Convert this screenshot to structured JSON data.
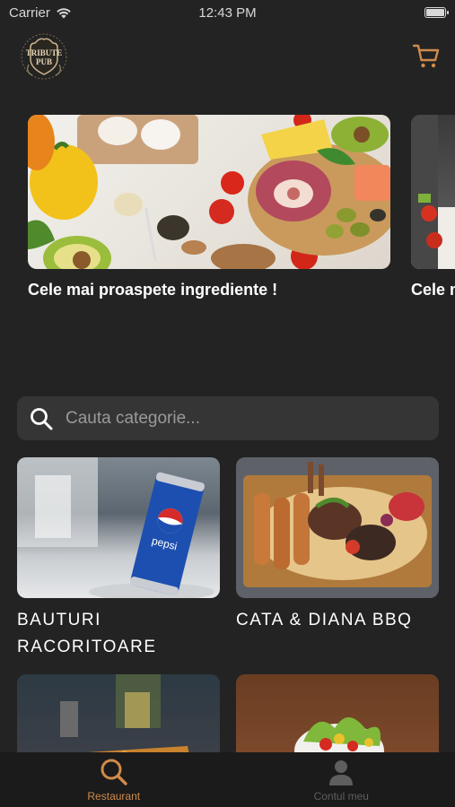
{
  "status_bar": {
    "carrier": "Carrier",
    "time": "12:43 PM"
  },
  "header": {
    "logo_icon": "tribute-pub-logo",
    "cart_icon": "cart-icon"
  },
  "banners": [
    {
      "caption": "Cele mai proaspete ingrediente !"
    },
    {
      "caption": "Cele mai proaspete ingrediente !"
    }
  ],
  "search": {
    "placeholder": "Cauta categorie...",
    "value": ""
  },
  "categories": [
    {
      "name": "BAUTURI RACORITOARE"
    },
    {
      "name": "CATA & DIANA BBQ"
    },
    {
      "name": ""
    },
    {
      "name": ""
    }
  ],
  "tabbar": {
    "items": [
      {
        "label": "Restaurant",
        "icon": "search-icon",
        "active": true
      },
      {
        "label": "Contul meu",
        "icon": "user-icon",
        "active": false
      }
    ]
  },
  "colors": {
    "accent": "#d08b4a",
    "background": "#232323",
    "surface": "#353535",
    "tabbar": "#1b1b1b"
  }
}
